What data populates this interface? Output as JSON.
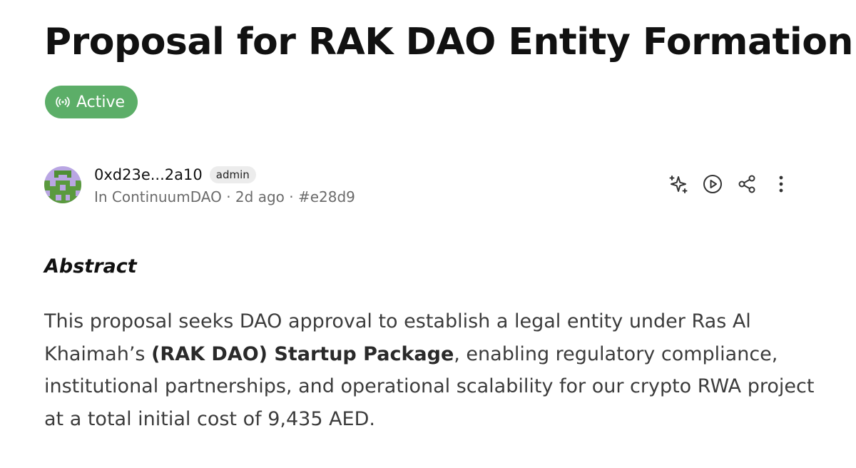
{
  "proposal": {
    "title": "Proposal for RAK DAO Entity Formation",
    "status": "Active",
    "status_color": "#5cae68"
  },
  "author": {
    "address": "0xd23e...2a10",
    "role": "admin",
    "meta": "In ContinuumDAO · 2d ago · #e28d9"
  },
  "actions": [
    {
      "icon": "sparkle-icon"
    },
    {
      "icon": "play-circle-icon"
    },
    {
      "icon": "share-icon"
    },
    {
      "icon": "more-vertical-icon"
    }
  ],
  "abstract": {
    "heading": "Abstract",
    "text_before": "This proposal seeks DAO approval to establish a legal entity under Ras Al Khaimah’s ",
    "text_bold": "(RAK DAO) Startup Package",
    "text_after": ", enabling regulatory compliance, institutional partnerships, and operational scalability for our crypto RWA project at a total initial cost of 9,435 AED."
  }
}
